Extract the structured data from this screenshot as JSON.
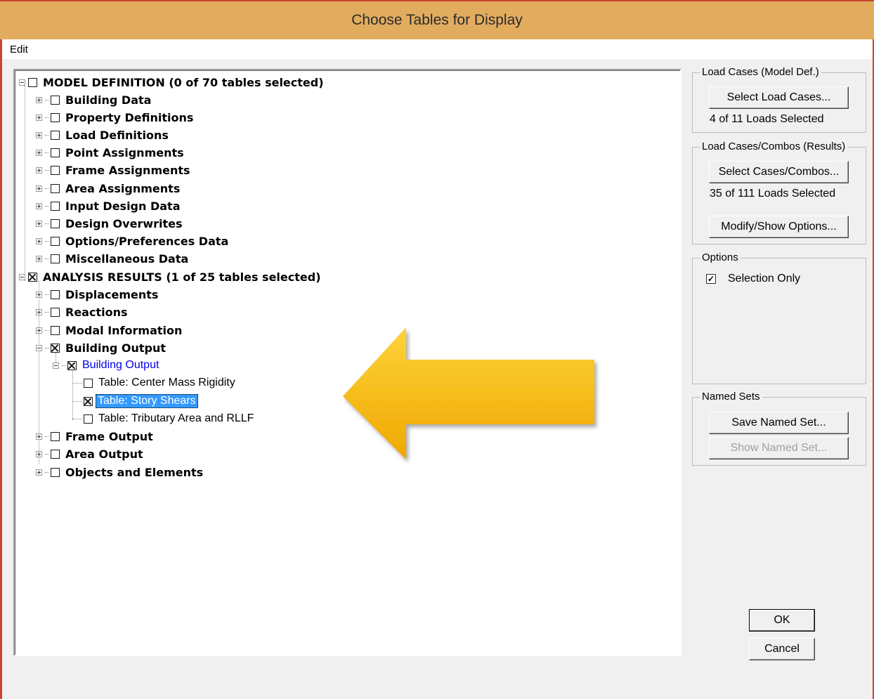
{
  "window": {
    "title": "Choose Tables for Display"
  },
  "menu": {
    "edit": "Edit"
  },
  "tree": {
    "model_definition": "MODEL DEFINITION  (0 of 70 tables selected)",
    "model_children": [
      "Building Data",
      "Property Definitions",
      "Load Definitions",
      "Point Assignments",
      "Frame Assignments",
      "Area Assignments",
      "Input Design Data",
      "Design Overwrites",
      "Options/Preferences Data",
      "Miscellaneous Data"
    ],
    "analysis_results": "ANALYSIS RESULTS  (1 of 25 tables selected)",
    "analysis_children_before": [
      "Displacements",
      "Reactions",
      "Modal Information"
    ],
    "building_output": "Building Output",
    "building_output_sub": "Building Output",
    "tables": [
      "Table:  Center Mass Rigidity",
      "Table:  Story Shears",
      "Table:  Tributary Area and RLLF"
    ],
    "analysis_children_after": [
      "Frame Output",
      "Area Output",
      "Objects and Elements"
    ]
  },
  "load_cases_model": {
    "legend": "Load Cases (Model Def.)",
    "button": "Select Load Cases...",
    "status": "4  of  11  Loads Selected"
  },
  "load_cases_results": {
    "legend": "Load Cases/Combos (Results)",
    "button": "Select Cases/Combos...",
    "status": "35  of  111  Loads Selected",
    "modify_button": "Modify/Show Options..."
  },
  "options": {
    "legend": "Options",
    "selection_only": "Selection Only",
    "selection_only_checked": true
  },
  "named_sets": {
    "legend": "Named Sets",
    "save_button": "Save Named Set...",
    "show_button": "Show Named Set..."
  },
  "buttons": {
    "ok": "OK",
    "cancel": "Cancel"
  },
  "colors": {
    "titlebar": "#e2ac5f",
    "selection": "#3399ff",
    "arrow": "#f5b90f"
  }
}
